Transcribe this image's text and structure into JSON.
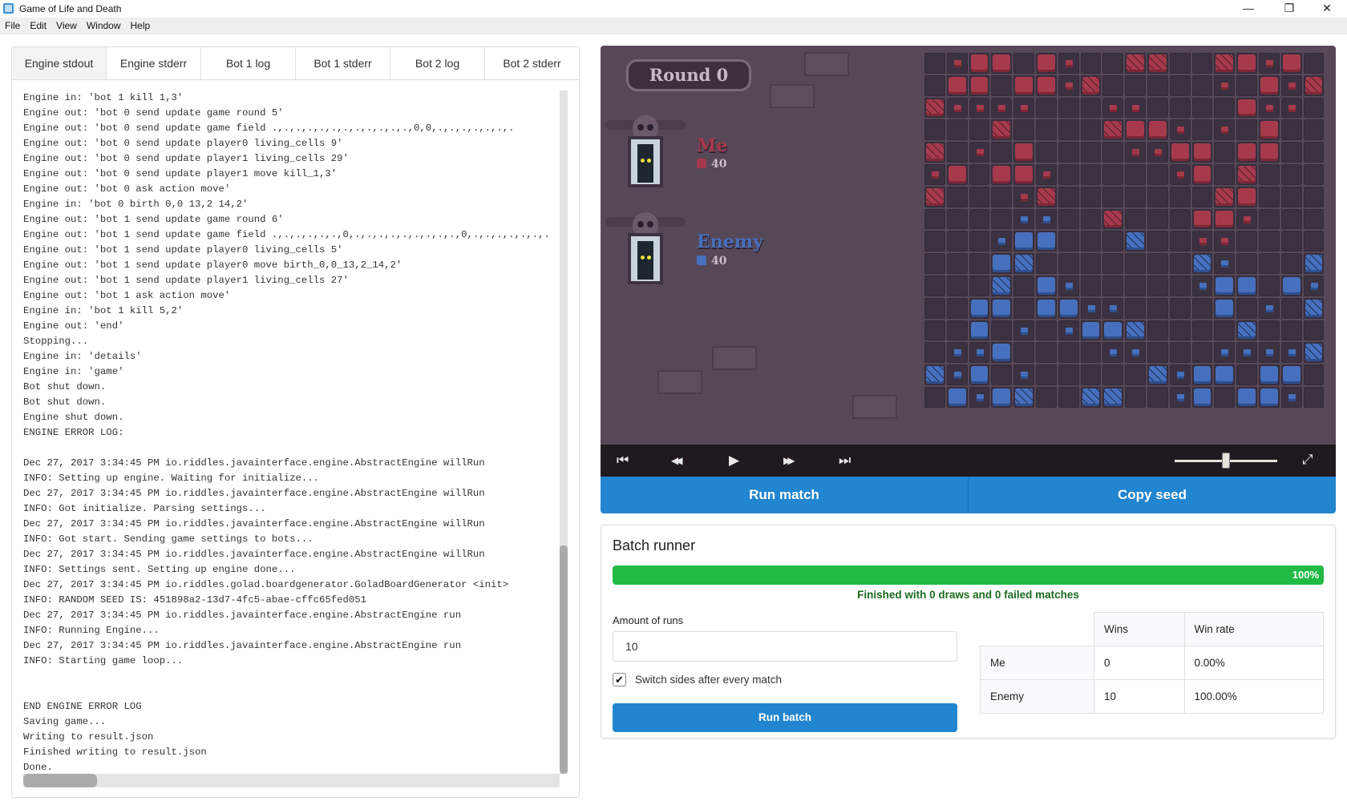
{
  "window": {
    "title": "Game of Life and Death",
    "controls": {
      "minimize": "—",
      "restore": "❐",
      "close": "✕"
    }
  },
  "menu": [
    "File",
    "Edit",
    "View",
    "Window",
    "Help"
  ],
  "log_tabs": [
    {
      "label": "Engine stdout",
      "active": true
    },
    {
      "label": "Engine stderr",
      "active": false
    },
    {
      "label": "Bot 1 log",
      "active": false
    },
    {
      "label": "Bot 1 stderr",
      "active": false
    },
    {
      "label": "Bot 2 log",
      "active": false
    },
    {
      "label": "Bot 2 stderr",
      "active": false
    }
  ],
  "log_lines": [
    "Engine in: 'bot 1 kill 1,3'",
    "Engine out: 'bot 0 send update game round 5'",
    "Engine out: 'bot 0 send update game field .,.,.,.,.,.,.,.,.,.,.,.,0,0,.,.,.,.,.,.,.",
    "Engine out: 'bot 0 send update player0 living_cells 9'",
    "Engine out: 'bot 0 send update player1 living_cells 29'",
    "Engine out: 'bot 0 send update player1 move kill_1,3'",
    "Engine out: 'bot 0 ask action move'",
    "Engine in: 'bot 0 birth 0,0 13,2 14,2'",
    "Engine out: 'bot 1 send update game round 6'",
    "Engine out: 'bot 1 send update game field .,.,.,.,.,.,0,.,.,.,.,.,.,.,.,.,0,.,.,.,.,.,.,.",
    "Engine out: 'bot 1 send update player0 living_cells 5'",
    "Engine out: 'bot 1 send update player0 move birth_0,0_13,2_14,2'",
    "Engine out: 'bot 1 send update player1 living_cells 27'",
    "Engine out: 'bot 1 ask action move'",
    "Engine in: 'bot 1 kill 5,2'",
    "Engine out: 'end'",
    "Stopping...",
    "Engine in: 'details'",
    "Engine in: 'game'",
    "Bot shut down.",
    "Bot shut down.",
    "Engine shut down.",
    "ENGINE ERROR LOG:",
    "",
    "Dec 27, 2017 3:34:45 PM io.riddles.javainterface.engine.AbstractEngine willRun",
    "INFO: Setting up engine. Waiting for initialize...",
    "Dec 27, 2017 3:34:45 PM io.riddles.javainterface.engine.AbstractEngine willRun",
    "INFO: Got initialize. Parsing settings...",
    "Dec 27, 2017 3:34:45 PM io.riddles.javainterface.engine.AbstractEngine willRun",
    "INFO: Got start. Sending game settings to bots...",
    "Dec 27, 2017 3:34:45 PM io.riddles.javainterface.engine.AbstractEngine willRun",
    "INFO: Settings sent. Setting up engine done...",
    "Dec 27, 2017 3:34:45 PM io.riddles.golad.boardgenerator.GoladBoardGenerator <init>",
    "INFO: RANDOM SEED IS: 451898a2-13d7-4fc5-abae-cffc65fed051",
    "Dec 27, 2017 3:34:45 PM io.riddles.javainterface.engine.AbstractEngine run",
    "INFO: Running Engine...",
    "Dec 27, 2017 3:34:45 PM io.riddles.javainterface.engine.AbstractEngine run",
    "INFO: Starting game loop...",
    "",
    "",
    "END ENGINE ERROR LOG",
    "Saving game...",
    "Writing to result.json",
    "Finished writing to result.json",
    "Done."
  ],
  "game": {
    "round_label": "Round 0",
    "players": [
      {
        "name": "Me",
        "cells": "40",
        "color": "#a63a4c"
      },
      {
        "name": "Enemy",
        "cells": "40",
        "color": "#4670be"
      }
    ],
    "board_legend": {
      "R": "red living",
      "r": "red birth marker",
      "X": "red dying",
      "B": "blue living",
      "b": "blue birth marker",
      "Y": "blue dying",
      ".": "empty"
    },
    "board": [
      ".rRR.Rr..XX..XRrR.",
      ".RR.RRrX.....r.RrX",
      "Xrrrr...rr....Rrr.",
      "...X....XRRr.r.R..",
      "X.r.R....rrRR.RR..",
      "rR.RRr.....rR.X...",
      "X...rX.......XR...",
      "....bb..X...RRr...",
      "...bBB...Y..rr....",
      "...BY.......Yb...Y",
      "...Y.Bb.....bBB.Bb",
      "..BB.BBbb....B.b.Y",
      "..B.b.bBBY....Y...",
      ".bbB....bb...bbbbY",
      "YbB.b.....YbBB.BB.",
      ".BbBY..YY..bB.BBb."
    ]
  },
  "playback": {
    "buttons": [
      {
        "name": "skip-to-start",
        "glyph": "⏮"
      },
      {
        "name": "step-back",
        "glyph": "◀◀"
      },
      {
        "name": "play",
        "glyph": "▶"
      },
      {
        "name": "step-forward",
        "glyph": "▶▶"
      },
      {
        "name": "skip-to-end",
        "glyph": "⏭"
      }
    ],
    "speed": 0.5,
    "fullscreen_glyph": "⤢"
  },
  "actions": {
    "run_match": "Run match",
    "copy_seed": "Copy seed"
  },
  "batch": {
    "title": "Batch runner",
    "progress_percent": 100,
    "progress_label": "100%",
    "status": "Finished with 0 draws and 0 failed matches",
    "runs_label": "Amount of runs",
    "runs_value": "10",
    "switch_sides_checked": true,
    "switch_sides_label": "Switch sides after every match",
    "run_button": "Run batch",
    "table": {
      "headers": [
        "",
        "Wins",
        "Win rate"
      ],
      "rows": [
        {
          "player": "Me",
          "wins": "0",
          "rate": "0.00%"
        },
        {
          "player": "Enemy",
          "wins": "10",
          "rate": "100.00%"
        }
      ]
    }
  }
}
